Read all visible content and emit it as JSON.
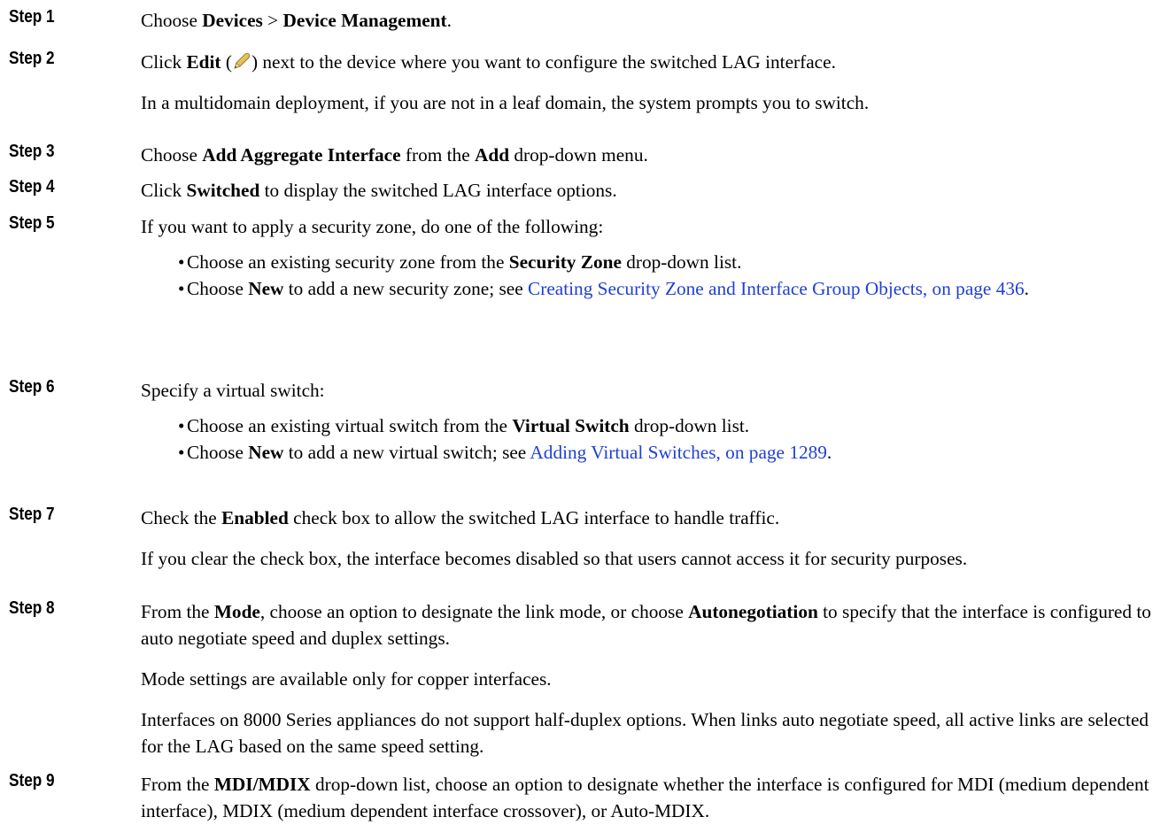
{
  "steps": [
    {
      "label": "Step 1",
      "pre": "Choose ",
      "b1": "Devices",
      "mid": " > ",
      "b2": "Device Management",
      "post": "."
    },
    {
      "label": "Step 2",
      "pre": "Click ",
      "b1": "Edit",
      "paren_open": " (",
      "icon": "pencil-icon",
      "paren_close": ")",
      "post": " next to the device where you want to configure the switched LAG interface.",
      "note": "In a multidomain deployment, if you are not in a leaf domain, the system prompts you to switch."
    },
    {
      "label": "Step 3",
      "pre": "Choose ",
      "b1": "Add Aggregate Interface",
      "mid": " from the ",
      "b2": "Add",
      "post": " drop-down menu."
    },
    {
      "label": "Step 4",
      "pre": "Click ",
      "b1": "Switched",
      "post": " to display the switched LAG interface options."
    },
    {
      "label": "Step 5",
      "text": "If you want to apply a security zone, do one of the following:",
      "bullets": [
        {
          "pre": "Choose an existing security zone from the ",
          "bold": "Security Zone",
          "post": " drop-down list."
        },
        {
          "pre": "Choose ",
          "bold": "New",
          "mid": " to add a new security zone; see ",
          "link": "Creating Security Zone and Interface Group Objects, on page 436",
          "post": "."
        }
      ]
    },
    {
      "label": "Step 6",
      "text": "Specify a virtual switch:",
      "bullets": [
        {
          "pre": "Choose an existing virtual switch from the ",
          "bold": "Virtual Switch",
          "post": " drop-down list."
        },
        {
          "pre": "Choose ",
          "bold": "New",
          "mid": " to add a new virtual switch; see ",
          "link": "Adding Virtual Switches, on page 1289",
          "post": "."
        }
      ]
    },
    {
      "label": "Step 7",
      "pre": "Check the ",
      "b1": "Enabled",
      "post": " check box to allow the switched LAG interface to handle traffic.",
      "note": "If you clear the check box, the interface becomes disabled so that users cannot access it for security purposes."
    },
    {
      "label": "Step 8",
      "pre": "From the ",
      "b1": "Mode",
      "mid": ", choose an option to designate the link mode, or choose ",
      "b2": "Autonegotiation",
      "post": " to specify that the interface is configured to auto negotiate speed and duplex settings.",
      "note": "Mode settings are available only for copper interfaces.",
      "note2": "Interfaces on 8000 Series appliances do not support half-duplex options. When links auto negotiate speed, all active links are selected for the LAG based on the same speed setting."
    },
    {
      "label": "Step 9",
      "pre": "From the ",
      "b1": "MDI/MDIX",
      "post": " drop-down list, choose an option to designate whether the interface is configured for MDI (medium dependent interface), MDIX (medium dependent interface crossover), or Auto-MDIX."
    }
  ]
}
